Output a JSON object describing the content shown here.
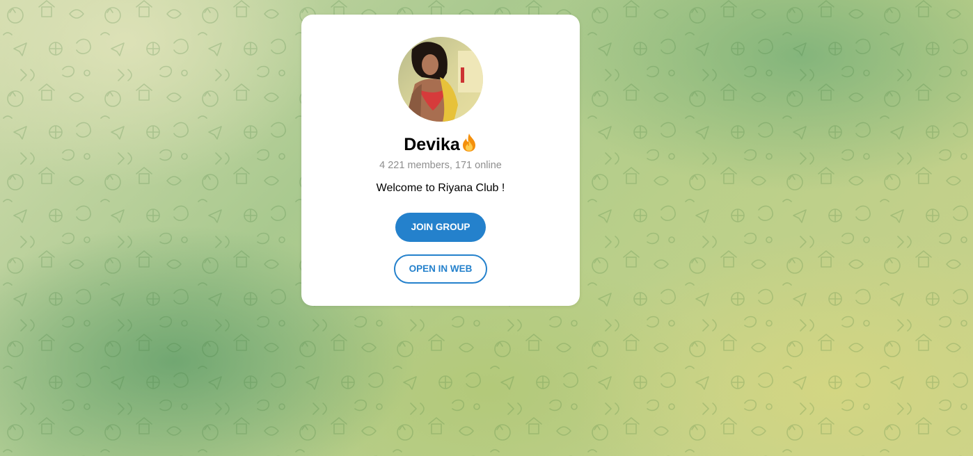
{
  "channel": {
    "name": "Devika",
    "title_emoji_icon": "fire-emoji-icon",
    "members_text": "4 221 members, 171 online",
    "description": "Welcome to Riyana Club !"
  },
  "actions": {
    "join_label": "JOIN GROUP",
    "open_web_label": "OPEN IN WEB"
  },
  "colors": {
    "accent": "#2481cc",
    "card_bg": "#ffffff",
    "muted_text": "#8e8e8e"
  },
  "icons": {
    "avatar": "profile-photo",
    "background": "doodle-pattern"
  }
}
